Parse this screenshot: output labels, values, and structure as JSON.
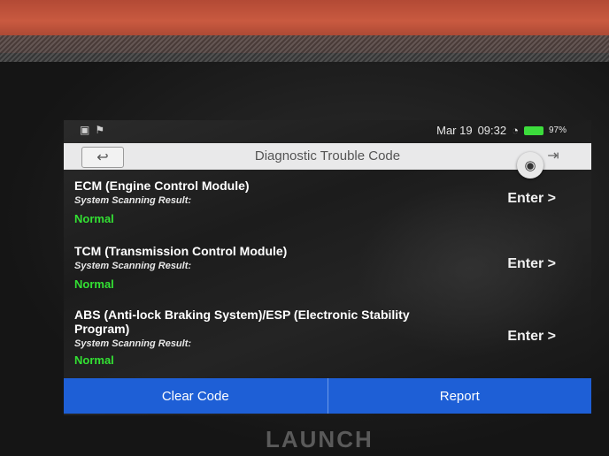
{
  "status_bar": {
    "date": "Mar 19",
    "time": "09:32",
    "battery": "97%"
  },
  "header": {
    "title": "Diagnostic Trouble Code"
  },
  "modules": [
    {
      "name": "ECM (Engine Control Module)",
      "scan_label": "System Scanning Result:",
      "result": "Normal",
      "action": "Enter >"
    },
    {
      "name": "TCM (Transmission Control Module)",
      "scan_label": "System Scanning Result:",
      "result": "Normal",
      "action": "Enter >"
    },
    {
      "name": "ABS (Anti-lock Braking System)/ESP (Electronic Stability Program)",
      "scan_label": "System Scanning Result:",
      "result": "Normal",
      "action": "Enter >"
    }
  ],
  "footer": {
    "clear_code": "Clear Code",
    "report": "Report"
  },
  "device_brand": "LAUNCH",
  "colors": {
    "accent": "#1e5fd6",
    "normal_status": "#33e033"
  },
  "icons": {
    "back": "back-arrow-icon",
    "exit": "exit-icon",
    "camera": "camera-icon",
    "wifi": "wifi-icon",
    "battery": "battery-icon"
  }
}
